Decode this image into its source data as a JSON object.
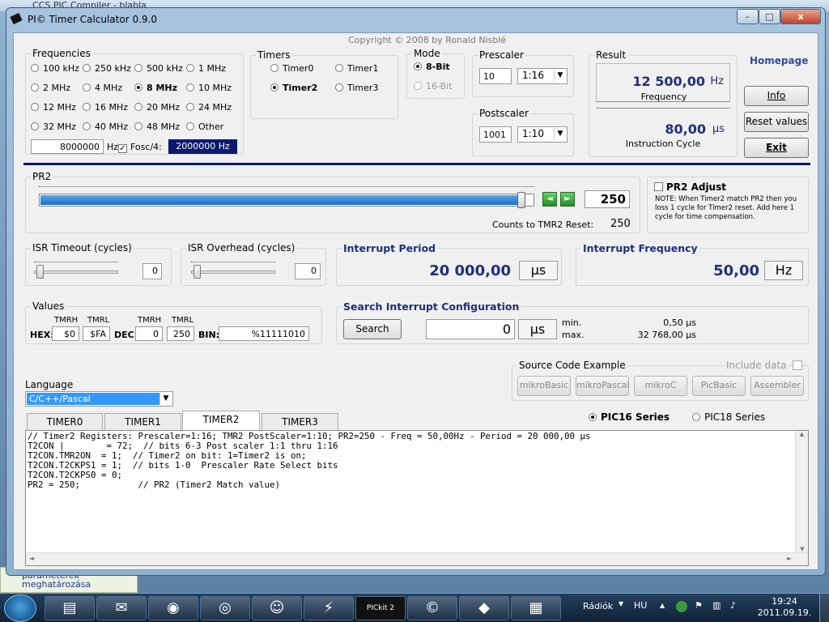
{
  "background": {
    "top_text": "CCS PIC Compiler - blabla",
    "left_panel": [
      "paraméterek",
      "meghatározása"
    ]
  },
  "window": {
    "title": "PI© Timer Calculator 0.9.0",
    "copyright": "Copyright © 2008 by Ronald Nisblé",
    "controls": {
      "minimize": "–",
      "maximize": "□",
      "close": "x"
    }
  },
  "frequencies": {
    "title": "Frequencies",
    "options": [
      "100 kHz",
      "250 kHz",
      "500 kHz",
      "1 MHz",
      "2 MHz",
      "4 MHz",
      "8 MHz",
      "10 MHz",
      "12 MHz",
      "16 MHz",
      "20 MHz",
      "24 MHz",
      "32 MHz",
      "40 MHz",
      "48 MHz",
      "Other"
    ],
    "selected": "8 MHz",
    "value": "8000000",
    "unit": "Hz",
    "fosc_label": "Fosc/4:",
    "fosc_checked": true,
    "fosc_value": "2000000  Hz"
  },
  "timers": {
    "title": "Timers",
    "options": [
      "Timer0",
      "Timer1",
      "Timer2",
      "Timer3"
    ],
    "selected": "Timer2"
  },
  "mode": {
    "title": "Mode",
    "options": [
      "8-Bit",
      "16-Bit"
    ],
    "selected": "8-Bit"
  },
  "prescaler": {
    "title": "Prescaler",
    "value": "10",
    "ratio": "1:16"
  },
  "postscaler": {
    "title": "Postscaler",
    "value": "1001",
    "ratio": "1:10"
  },
  "result": {
    "title": "Result",
    "frequency_value": "12 500,00",
    "frequency_unit": "Hz",
    "frequency_label": "Frequency",
    "cycle_value": "80,00",
    "cycle_unit": "µs",
    "cycle_label": "Instruction Cycle"
  },
  "side_buttons": {
    "homepage": "Homepage",
    "info": "Info",
    "reset": "Reset values",
    "exit": "Exit"
  },
  "pr2": {
    "title": "PR2",
    "value": "250",
    "slider_fraction": 0.98,
    "counts_label": "Counts to TMR2 Reset:",
    "counts_value": "250",
    "left_arrow": "◄",
    "right_arrow": "►"
  },
  "pr2_adjust": {
    "title": "PR2 Adjust",
    "checked": false,
    "note": "NOTE: When Timer2 match PR2 then you loss 1 cycle for Timer2 reset. Add here 1 cycle for time compensation."
  },
  "isr_timeout": {
    "title": "ISR Timeout  (cycles)",
    "value": "0",
    "slider_fraction": 0.0
  },
  "isr_overhead": {
    "title": "ISR Overhead  (cycles)",
    "value": "0",
    "slider_fraction": 0.0
  },
  "interrupt_period": {
    "title": "Interrupt Period",
    "value": "20 000,00",
    "unit": "µs"
  },
  "interrupt_frequency": {
    "title": "Interrupt Frequency",
    "value": "50,00",
    "unit": "Hz"
  },
  "values": {
    "title": "Values",
    "hex_label": "HEX:",
    "dec_label": "DEC:",
    "bin_label": "BIN:",
    "tmrh": "TMRH",
    "tmrl": "TMRL",
    "hex_h": "$0",
    "hex_l": "$FA",
    "dec_h": "0",
    "dec_l": "250",
    "bin": "%11111010"
  },
  "search": {
    "title": "Search Interrupt Configuration",
    "button": "Search",
    "value": "0",
    "unit": "µs",
    "min_label": "min.",
    "min_value": "0,50  µs",
    "max_label": "max.",
    "max_value": "32 768,00  µs"
  },
  "source_code": {
    "title": "Source Code Example",
    "include_label": "Include data",
    "buttons": [
      "mikroBasic",
      "mikroPascal",
      "mikroC",
      "PicBasic",
      "Assembler"
    ]
  },
  "language": {
    "label": "Language",
    "value": "C/C++/Pascal"
  },
  "tabs": {
    "items": [
      "TIMER0",
      "TIMER1",
      "TIMER2",
      "TIMER3"
    ],
    "active": "TIMER2"
  },
  "series": {
    "options": [
      "PIC16 Series",
      "PIC18 Series"
    ],
    "selected": "PIC16 Series"
  },
  "code": [
    "// Timer2 Registers: Prescaler=1:16; TMR2 PostScaler=1:10; PR2=250 - Freq = 50,00Hz - Period = 20 000,00 µs",
    "T2CON |        = 72;  // bits 6-3 Post scaler 1:1 thru 1:16",
    "T2CON.TMR2ON  = 1;  // Timer2 on bit: 1=Timer2 is on;",
    "T2CON.T2CKPS1 = 1;  // bits 1-0  Prescaler Rate Select bits",
    "T2CON.T2CKPS0 = 0;",
    "PR2 = 250;           // PR2 (Timer2 Match value)"
  ],
  "taskbar": {
    "apps": [
      "file-explorer-icon",
      "thunderbird-icon",
      "firefox-icon",
      "chrome-icon",
      "people-icon",
      "winamp-icon",
      "pickit2-icon",
      "ccs-icon",
      "chip-icon",
      "calculator-icon"
    ],
    "pickit_label": "PICkit 2",
    "toolbar_label": "Rádiók",
    "lang": "HU",
    "time": "19:24",
    "date": "2011.09.19."
  }
}
